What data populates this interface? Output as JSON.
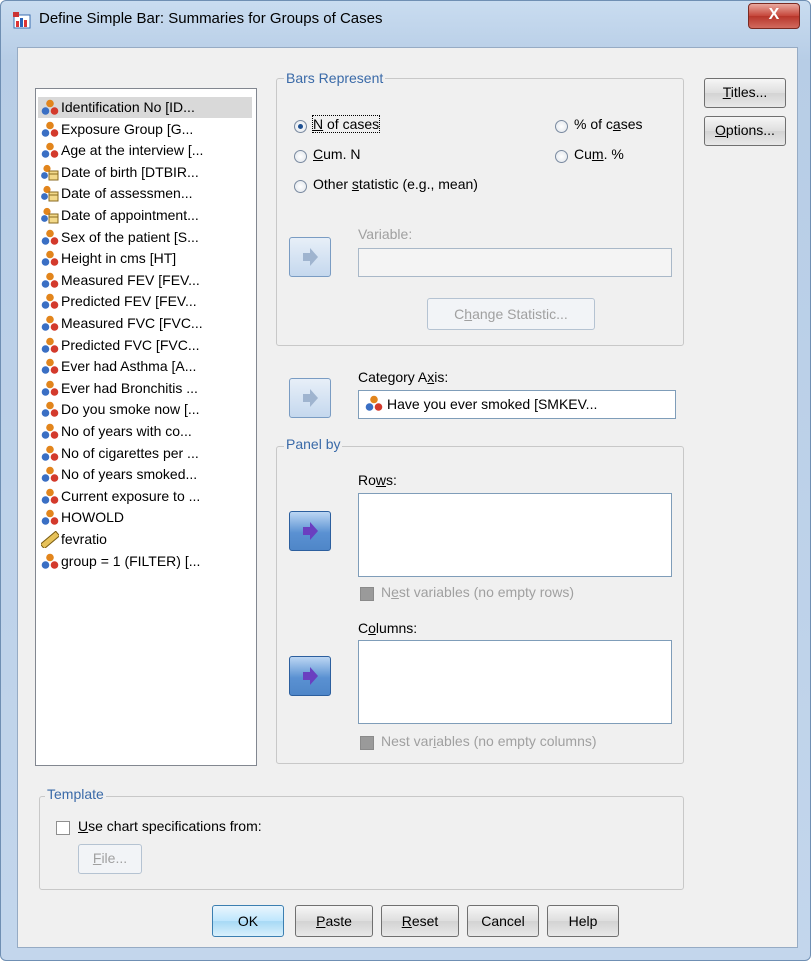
{
  "window": {
    "title": "Define Simple Bar: Summaries for Groups of Cases",
    "close_label": "X"
  },
  "variables": [
    {
      "label": "Identification No [ID...",
      "icon": "nominal-variable-icon"
    },
    {
      "label": "Exposure Group [G...",
      "icon": "nominal-variable-icon"
    },
    {
      "label": "Age at the interview [...",
      "icon": "nominal-variable-icon"
    },
    {
      "label": "Date of birth [DTBIR...",
      "icon": "date-variable-icon"
    },
    {
      "label": "Date of assessmen...",
      "icon": "date-variable-icon"
    },
    {
      "label": "Date of appointment...",
      "icon": "date-variable-icon"
    },
    {
      "label": "Sex of the patient [S...",
      "icon": "nominal-variable-icon"
    },
    {
      "label": "Height in cms [HT]",
      "icon": "nominal-variable-icon"
    },
    {
      "label": "Measured FEV [FEV...",
      "icon": "nominal-variable-icon"
    },
    {
      "label": "Predicted FEV [FEV...",
      "icon": "nominal-variable-icon"
    },
    {
      "label": "Measured FVC [FVC...",
      "icon": "nominal-variable-icon"
    },
    {
      "label": "Predicted FVC [FVC...",
      "icon": "nominal-variable-icon"
    },
    {
      "label": "Ever had Asthma [A...",
      "icon": "nominal-variable-icon"
    },
    {
      "label": "Ever had Bronchitis ...",
      "icon": "nominal-variable-icon"
    },
    {
      "label": "Do you smoke now [...",
      "icon": "nominal-variable-icon"
    },
    {
      "label": "No of years with co...",
      "icon": "nominal-variable-icon"
    },
    {
      "label": "No of cigarettes per ...",
      "icon": "nominal-variable-icon"
    },
    {
      "label": "No of years smoked...",
      "icon": "nominal-variable-icon"
    },
    {
      "label": "Current exposure to ...",
      "icon": "nominal-variable-icon"
    },
    {
      "label": "HOWOLD",
      "icon": "nominal-variable-icon"
    },
    {
      "label": "fevratio",
      "icon": "ruler-scale-icon"
    },
    {
      "label": "group = 1 (FILTER) [...",
      "icon": "nominal-variable-icon"
    }
  ],
  "bars_represent": {
    "title": "Bars Represent",
    "n_of_cases": {
      "pre": "",
      "key": "N",
      "post": " of cases",
      "selected": true
    },
    "pct_of_cases": {
      "pre": "% of c",
      "key": "a",
      "post": "ses",
      "selected": false
    },
    "cum_n": {
      "pre": "",
      "key": "C",
      "post": "um. N",
      "selected": false
    },
    "cum_pct": {
      "pre": "Cu",
      "key": "m",
      "post": ". %",
      "selected": false
    },
    "other_statistic": {
      "pre": "Other ",
      "key": "s",
      "post": "tatistic (e.g., mean)",
      "selected": false
    },
    "variable_label": "Variable:",
    "variable_value": "",
    "change_statistic": {
      "pre": "C",
      "key": "h",
      "post": "ange Statistic..."
    }
  },
  "category_axis": {
    "pre": "Category A",
    "key": "x",
    "post": "is:",
    "value": "Have you ever smoked [SMKEV..."
  },
  "panel_by": {
    "title": "Panel by",
    "rows": {
      "pre": "Ro",
      "key": "w",
      "post": "s:"
    },
    "nest_rows": {
      "pre": "N",
      "key": "e",
      "post": "st variables (no empty rows)",
      "checked": false
    },
    "columns": {
      "pre": "C",
      "key": "o",
      "post": "lumns:"
    },
    "nest_columns": {
      "pre": "Nest var",
      "key": "i",
      "post": "ables (no empty columns)",
      "checked": false
    }
  },
  "template": {
    "title": "Template",
    "use_spec": {
      "pre": "",
      "key": "U",
      "post": "se chart specifications from:",
      "checked": false
    },
    "file": {
      "pre": "",
      "key": "F",
      "post": "ile..."
    }
  },
  "side_buttons": {
    "titles": {
      "pre": "",
      "key": "T",
      "post": "itles..."
    },
    "options": {
      "pre": "",
      "key": "O",
      "post": "ptions..."
    }
  },
  "bottom_buttons": {
    "ok": "OK",
    "paste": {
      "pre": "",
      "key": "P",
      "post": "aste"
    },
    "reset": {
      "pre": "",
      "key": "R",
      "post": "eset"
    },
    "cancel": "Cancel",
    "help": "Help"
  },
  "colors": {
    "accent": "#3a6aa8",
    "selected_row": "#d9d9d9",
    "arrow_active": "#5a91d2"
  }
}
